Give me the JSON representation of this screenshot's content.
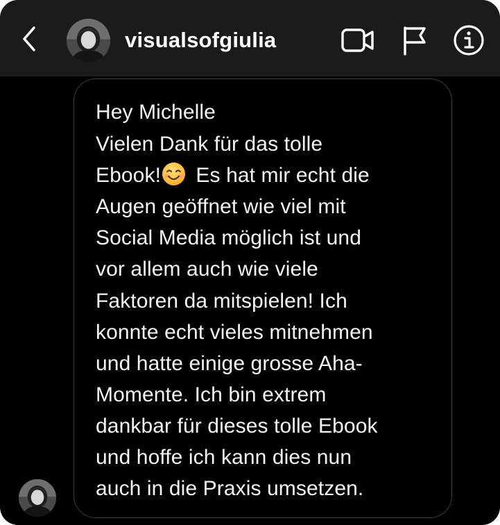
{
  "header": {
    "username": "visualsofgiulia",
    "back_icon": "chevron-left-icon",
    "video_icon": "video-camera-icon",
    "flag_icon": "flag-icon",
    "info_icon": "info-icon"
  },
  "message": {
    "lines": [
      "Hey Michelle",
      "Vielen Dank für das tolle",
      "Ebook!",
      " Es hat mir echt die",
      "Augen geöffnet wie viel mit",
      "Social Media möglich ist und",
      "vor allem auch wie viele",
      "Faktoren da mitspielen! Ich",
      "konnte echt vieles mitnehmen",
      "und hatte einige grosse Aha-",
      "Momente. Ich bin extrem",
      "dankbar für dieses tolle Ebook",
      "und hoffe ich kann dies nun",
      "auch in die Praxis umsetzen."
    ],
    "emoji": "smiling-face-emoji"
  },
  "colors": {
    "background": "#000000",
    "header_bg": "#1b1b1b",
    "bubble_border": "#3c3c3c",
    "text": "#ffffff"
  }
}
